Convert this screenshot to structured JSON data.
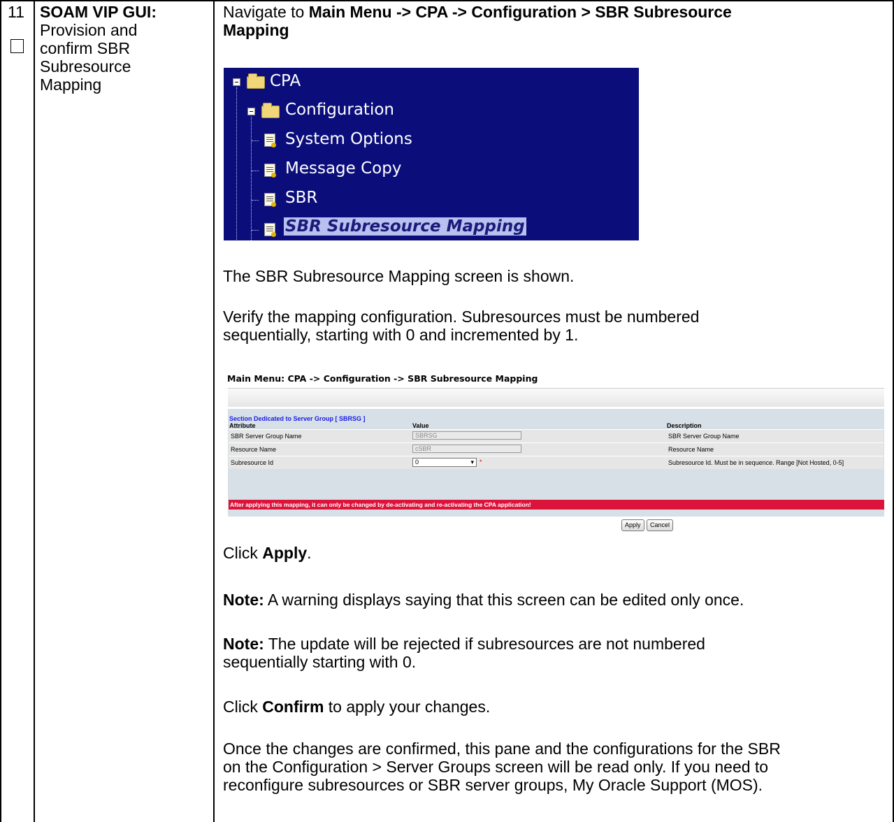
{
  "step": {
    "number": "11",
    "title_bold": "SOAM VIP GUI:",
    "title_rest": [
      "Provision and",
      "confirm SBR",
      "Subresource",
      "Mapping"
    ]
  },
  "instructions": {
    "nav_prefix": "Navigate to ",
    "nav_bold_line1": "Main Menu -> CPA -> Configuration > SBR Subresource",
    "nav_bold_line2": "Mapping",
    "shown": "The SBR Subresource Mapping screen is shown.",
    "verify_line1": "Verify the mapping configuration. Subresources must be numbered",
    "verify_line2": "sequentially, starting with 0 and incremented by 1.",
    "click_apply_prefix": "Click ",
    "click_apply_bold": "Apply",
    "click_apply_suffix": ".",
    "note_label": "Note:",
    "note1": " A warning displays saying that this screen can be edited only once.",
    "note2_line1": " The update will be rejected if subresources are not numbered",
    "note2_line2": "sequentially starting with 0.",
    "confirm_prefix": "Click ",
    "confirm_bold": "Confirm",
    "confirm_suffix": " to apply your changes.",
    "final_line1": "Once the changes are confirmed, this pane and the configurations for the SBR",
    "final_line2": "on the Configuration > Server Groups screen will be read only. If you need to",
    "final_line3": "reconfigure subresources or SBR server groups, My Oracle Support (MOS)."
  },
  "tree": {
    "items": [
      "CPA",
      "Configuration",
      "System Options",
      "Message Copy",
      "SBR",
      "SBR Subresource Mapping"
    ],
    "background": "#0b0e7a"
  },
  "form": {
    "title": "Main Menu: CPA -> Configuration -> SBR Subresource Mapping",
    "section": "Section Dedicated to Server Group [ SBRSG ]",
    "headers": [
      "Attribute",
      "Value",
      "Description"
    ],
    "rows": [
      {
        "attribute": "SBR Server Group Name",
        "value": "SBRSG",
        "description": "SBR Server Group Name"
      },
      {
        "attribute": "Resource Name",
        "value": "cSBR",
        "description": "Resource Name"
      },
      {
        "attribute": "Subresource Id",
        "value": "0",
        "description": "Subresource Id. Must be in sequence. Range [Not Hosted, 0-5]"
      }
    ],
    "required_mark": "*",
    "warning": "After applying this mapping, it can only be changed by de-activating and re-activating the CPA application!",
    "apply_label": "Apply",
    "cancel_label": "Cancel",
    "warning_color": "#dc143c"
  }
}
